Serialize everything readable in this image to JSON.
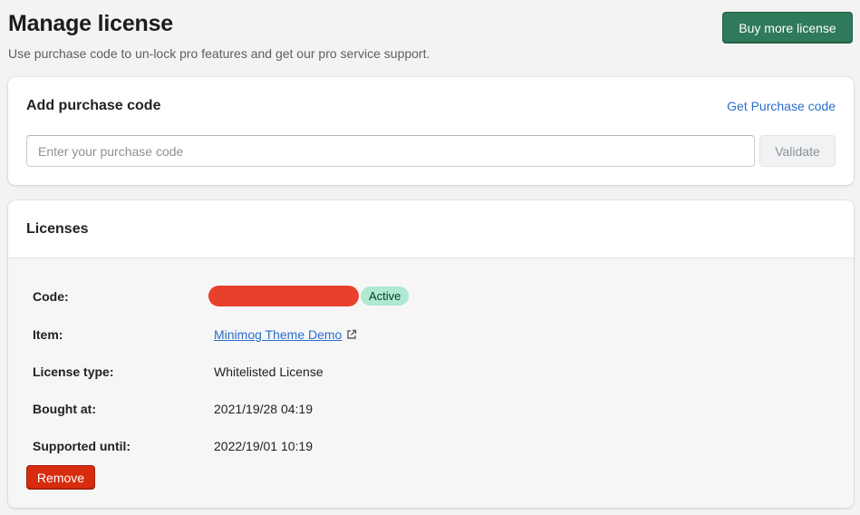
{
  "header": {
    "title": "Manage license",
    "subtitle": "Use purchase code to un-lock pro features and get our pro service support.",
    "buy_button_label": "Buy more license"
  },
  "add_purchase": {
    "heading": "Add purchase code",
    "get_code_link": "Get Purchase code",
    "input_placeholder": "Enter your purchase code",
    "input_value": "",
    "validate_label": "Validate"
  },
  "licenses": {
    "heading": "Licenses",
    "rows": [
      {
        "label": "Code:",
        "value": ""
      },
      {
        "label": "Item:",
        "value": "Minimog Theme Demo"
      },
      {
        "label": "License type:",
        "value": "Whitelisted License"
      },
      {
        "label": "Bought at:",
        "value": "2021/19/28 04:19"
      },
      {
        "label": "Supported until:",
        "value": "2022/19/01 10:19"
      }
    ],
    "status_badge": "Active",
    "remove_label": "Remove"
  },
  "icons": {
    "item_link_icon": "external-link-icon"
  },
  "colors": {
    "primary_button": "#2f7a5b",
    "link": "#2c6ecb",
    "destructive": "#d72c0d",
    "badge_bg": "#aee9d1",
    "redaction": "#e8402a",
    "page_bg": "#f3f3f3"
  }
}
